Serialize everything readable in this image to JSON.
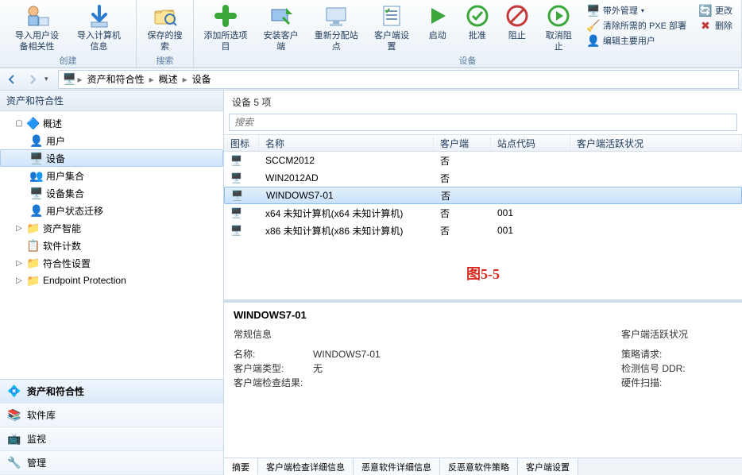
{
  "ribbon": {
    "groups": {
      "create": {
        "label": "创建",
        "import_user_device": "导入用户设备相关性",
        "import_computer": "导入计算机信息"
      },
      "search": {
        "label": "搜索",
        "saved_searches": "保存的搜索"
      },
      "device": {
        "label": "设备",
        "add_selected": "添加所选项目",
        "install_client": "安装客户端",
        "reassign_site": "重新分配站点",
        "client_settings": "客户端设置",
        "start": "启动",
        "approve": "批准",
        "block": "阻止",
        "unblock": "取消阻止"
      },
      "side": {
        "oob_mgmt": "带外管理",
        "clear_pxe": "清除所需的 PXE 部署",
        "edit_primary": "编辑主要用户",
        "refresh": "更改",
        "delete": "删除"
      }
    }
  },
  "breadcrumb": {
    "root": "资产和符合性",
    "l2": "概述",
    "l3": "设备"
  },
  "left": {
    "header": "资产和符合性",
    "tree": {
      "overview": "概述",
      "users": "用户",
      "devices": "设备",
      "user_collections": "用户集合",
      "device_collections": "设备集合",
      "user_state_migration": "用户状态迁移",
      "asset_intelligence": "资产智能",
      "software_metering": "软件计数",
      "compliance": "符合性设置",
      "endpoint": "Endpoint Protection"
    },
    "wunderbar": {
      "assets": "资产和符合性",
      "software": "软件库",
      "monitoring": "监视",
      "admin": "管理"
    }
  },
  "content": {
    "header": "设备 5 项",
    "search_placeholder": "搜索",
    "columns": {
      "icon": "图标",
      "name": "名称",
      "client": "客户端",
      "site_code": "站点代码",
      "activity": "客户端活跃状况"
    },
    "rows": [
      {
        "name": "SCCM2012",
        "client": "否",
        "site": "",
        "activity": ""
      },
      {
        "name": "WIN2012AD",
        "client": "否",
        "site": "",
        "activity": ""
      },
      {
        "name": "WINDOWS7-01",
        "client": "否",
        "site": "",
        "activity": "",
        "selected": true
      },
      {
        "name": "x64 未知计算机(x64 未知计算机)",
        "client": "否",
        "site": "001",
        "activity": ""
      },
      {
        "name": "x86 未知计算机(x86 未知计算机)",
        "client": "否",
        "site": "001",
        "activity": ""
      }
    ],
    "annotation": "图5-5"
  },
  "details": {
    "title": "WINDOWS7-01",
    "general": {
      "heading": "常规信息",
      "name_label": "名称:",
      "name_value": "WINDOWS7-01",
      "client_type_label": "客户端类型:",
      "client_type_value": "无",
      "check_result_label": "客户端检查结果:"
    },
    "activity": {
      "heading": "客户端活跃状况",
      "policy_label": "策略请求:",
      "ddr_label": "检测信号 DDR:",
      "hw_label": "硬件扫描:"
    },
    "tabs": {
      "summary": "摘要",
      "client_check": "客户端检查详细信息",
      "malware_detail": "恶意软件详细信息",
      "antimalware_policy": "反恶意软件策略",
      "client_settings": "客户端设置"
    }
  }
}
